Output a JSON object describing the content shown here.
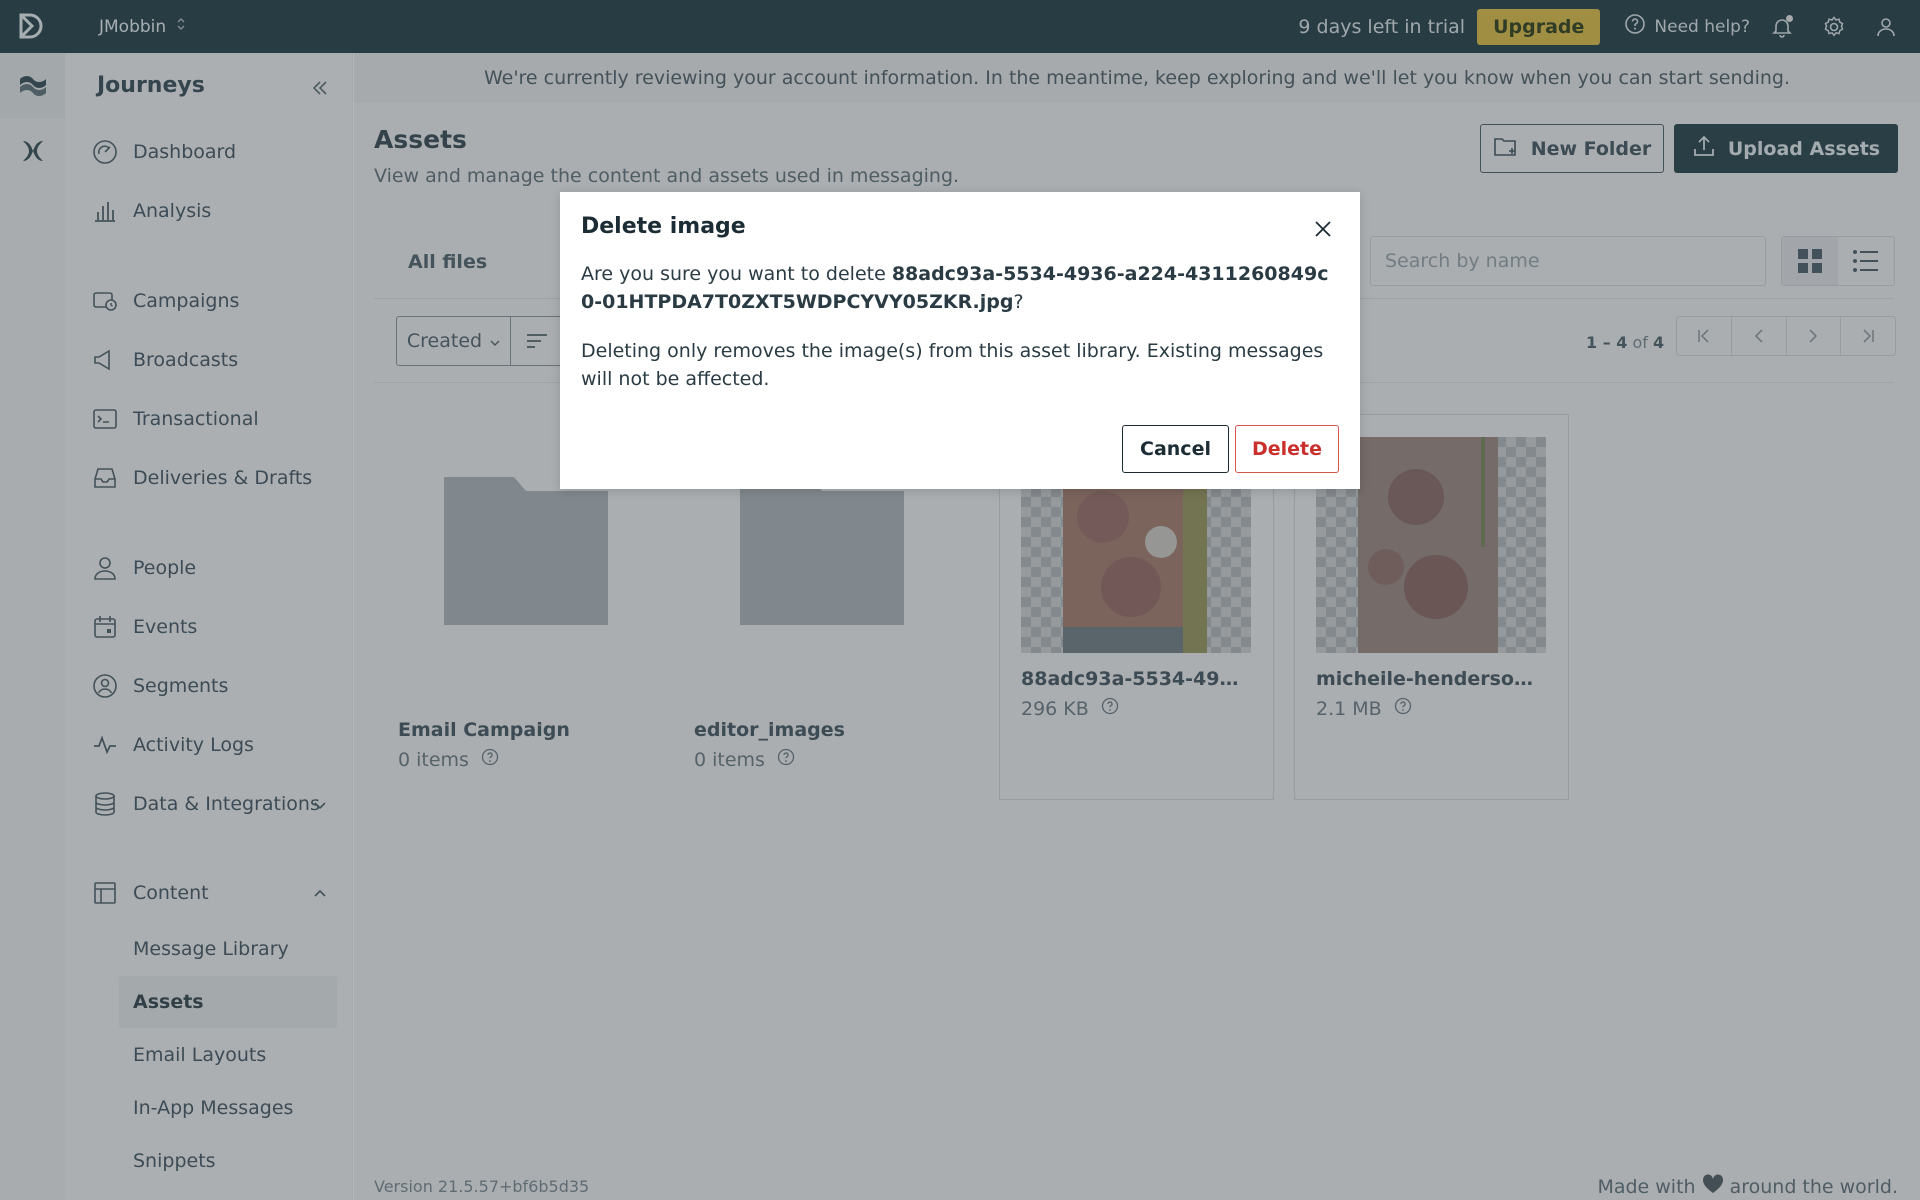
{
  "topbar": {
    "workspace": "JMobbin",
    "trial_text": "9 days left in trial",
    "upgrade_label": "Upgrade",
    "help_label": "Need help?"
  },
  "sidebar": {
    "title": "Journeys",
    "items": [
      {
        "label": "Dashboard",
        "icon": "dashboard-icon"
      },
      {
        "label": "Analysis",
        "icon": "bar-chart-icon"
      },
      {
        "label": "Campaigns",
        "icon": "campaign-icon"
      },
      {
        "label": "Broadcasts",
        "icon": "megaphone-icon"
      },
      {
        "label": "Transactional",
        "icon": "terminal-icon"
      },
      {
        "label": "Deliveries & Drafts",
        "icon": "inbox-icon"
      },
      {
        "label": "People",
        "icon": "person-icon"
      },
      {
        "label": "Events",
        "icon": "calendar-icon"
      },
      {
        "label": "Segments",
        "icon": "segments-icon"
      },
      {
        "label": "Activity Logs",
        "icon": "pulse-icon"
      },
      {
        "label": "Data & Integrations",
        "icon": "database-icon"
      },
      {
        "label": "Content",
        "icon": "layout-icon"
      }
    ],
    "content_sub": [
      "Message Library",
      "Assets",
      "Email Layouts",
      "In-App Messages",
      "Snippets"
    ]
  },
  "main": {
    "banner": "We're currently reviewing your account information. In the meantime, keep exploring and we'll let you know when you can start sending.",
    "title": "Assets",
    "subtitle": "View and manage the content and assets used in messaging.",
    "new_folder_label": "New Folder",
    "upload_label": "Upload Assets",
    "tab_all": "All files",
    "search_placeholder": "Search by name",
    "sort_label": "Created",
    "pager_range": "1 – 4",
    "pager_of": "of",
    "pager_total": "4",
    "cards": [
      {
        "name": "Email Campaign",
        "meta": "0 items",
        "kind": "folder"
      },
      {
        "name": "editor_images",
        "meta": "0 items",
        "kind": "folder"
      },
      {
        "name": "88adc93a-5534-4936-a224-4311260849c0-01HTPDA7T0ZXT5WDPCYVY05ZKR.jpg",
        "meta": "296 KB",
        "kind": "image"
      },
      {
        "name": "micheile-henderson-ay…",
        "meta": "2.1 MB",
        "kind": "image"
      }
    ],
    "version": "Version 21.5.57+bf6b5d35",
    "made_with_prefix": "Made with",
    "made_with_suffix": "around the world."
  },
  "modal": {
    "title": "Delete image",
    "body_prefix": "Are you sure you want to delete ",
    "filename": "88adc93a-5534-4936-a224-4311260849c0-01HTPDA7T0ZXT5WDPCYVY05ZKR.jpg",
    "body_suffix": "?",
    "body2": "Deleting only removes the image(s) from this asset library. Existing messages will not be affected.",
    "cancel_label": "Cancel",
    "delete_label": "Delete"
  },
  "colors": {
    "topbar": "#0b2a33",
    "accent": "#d9b833",
    "danger": "#c9302c"
  }
}
